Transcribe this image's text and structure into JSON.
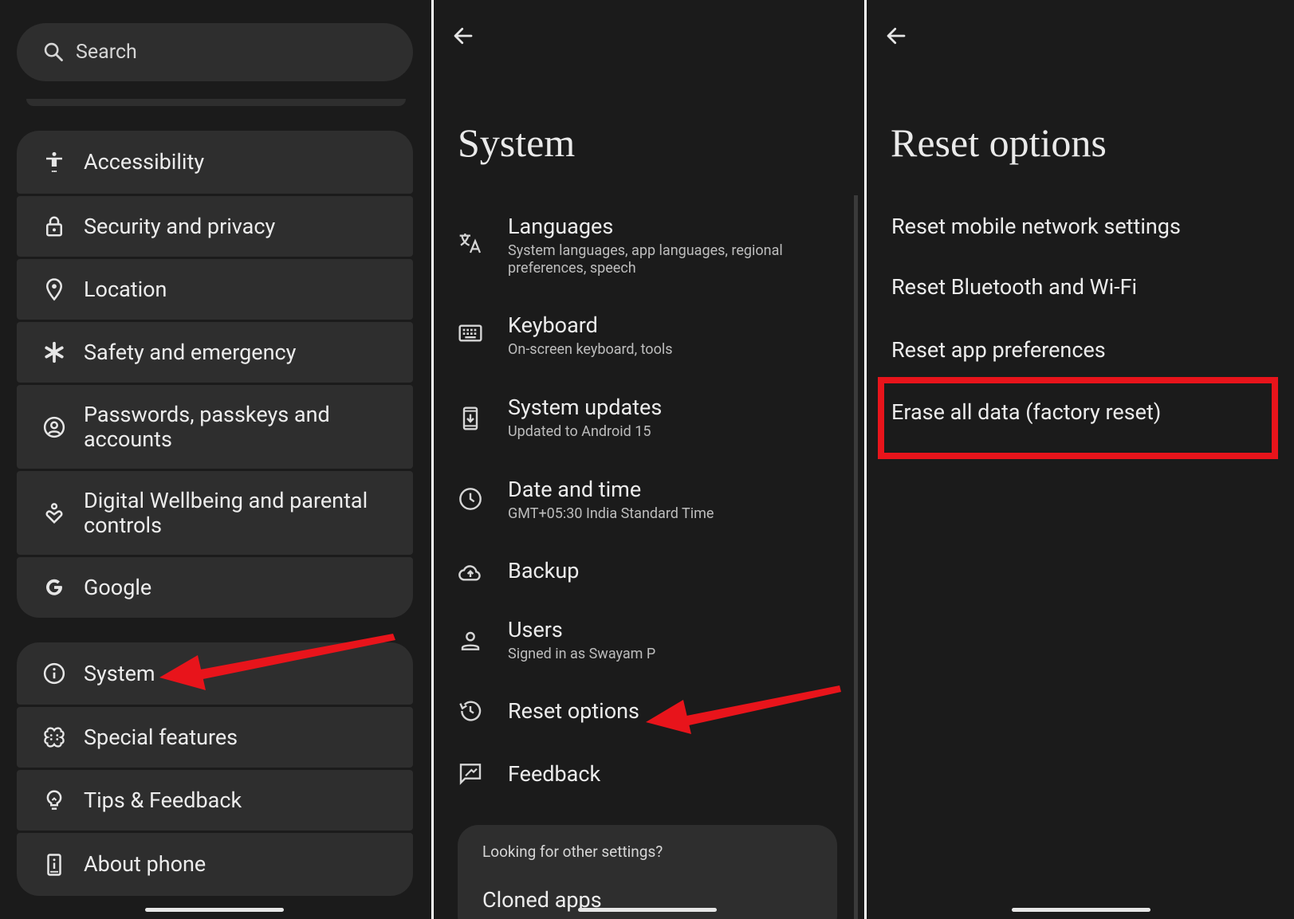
{
  "settings_panel": {
    "search_placeholder": "Search",
    "items": [
      {
        "label": "Accessibility",
        "icon": "accessibility-icon"
      },
      {
        "label": "Security and privacy",
        "icon": "lock-icon"
      },
      {
        "label": "Location",
        "icon": "location-pin-icon"
      },
      {
        "label": "Safety and emergency",
        "icon": "asterisk-icon"
      },
      {
        "label": "Passwords, passkeys and accounts",
        "icon": "account-circle-icon"
      },
      {
        "label": "Digital Wellbeing and parental controls",
        "icon": "wellbeing-icon"
      },
      {
        "label": "Google",
        "icon": "google-g-icon"
      },
      {
        "label": "System",
        "icon": "info-icon"
      },
      {
        "label": "Special features",
        "icon": "special-features-icon"
      },
      {
        "label": "Tips & Feedback",
        "icon": "lightbulb-icon"
      },
      {
        "label": "About phone",
        "icon": "phone-info-icon"
      }
    ]
  },
  "system_panel": {
    "title": "System",
    "items": [
      {
        "title": "Languages",
        "subtitle": "System languages, app languages, regional preferences, speech",
        "icon": "translate-icon"
      },
      {
        "title": "Keyboard",
        "subtitle": "On-screen keyboard, tools",
        "icon": "keyboard-icon"
      },
      {
        "title": "System updates",
        "subtitle": "Updated to Android 15",
        "icon": "system-update-icon"
      },
      {
        "title": "Date and time",
        "subtitle": "GMT+05:30 India Standard Time",
        "icon": "clock-icon"
      },
      {
        "title": "Backup",
        "subtitle": "",
        "icon": "cloud-upload-icon"
      },
      {
        "title": "Users",
        "subtitle": "Signed in as Swayam P",
        "icon": "person-icon"
      },
      {
        "title": "Reset options",
        "subtitle": "",
        "icon": "history-icon"
      },
      {
        "title": "Feedback",
        "subtitle": "",
        "icon": "feedback-icon"
      }
    ],
    "other_settings": {
      "question": "Looking for other settings?",
      "link": "Cloned apps"
    }
  },
  "reset_panel": {
    "title": "Reset options",
    "options": [
      "Reset mobile network settings",
      "Reset Bluetooth and Wi-Fi",
      "Reset app preferences",
      "Erase all data (factory reset)"
    ]
  },
  "colors": {
    "background": "#1b1b1b",
    "card": "#2e2e2e",
    "text": "#ececec",
    "annotation_red": "#e8141b"
  }
}
